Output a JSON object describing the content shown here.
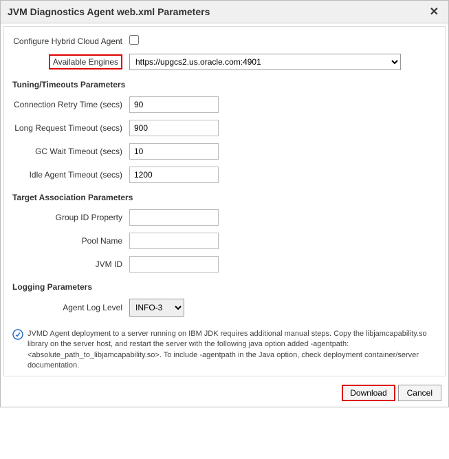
{
  "dialog": {
    "title": "JVM Diagnostics Agent web.xml Parameters"
  },
  "hybrid": {
    "label": "Configure Hybrid Cloud Agent",
    "checked": false
  },
  "engines": {
    "label": "Available Engines",
    "selected": "https://upgcs2.us.oracle.com:4901"
  },
  "sections": {
    "tuning": "Tuning/Timeouts Parameters",
    "target": "Target Association Parameters",
    "logging": "Logging Parameters"
  },
  "tuning": {
    "conn_retry_label": "Connection Retry Time (secs)",
    "conn_retry_value": "90",
    "long_req_label": "Long Request Timeout (secs)",
    "long_req_value": "900",
    "gc_wait_label": "GC Wait Timeout (secs)",
    "gc_wait_value": "10",
    "idle_agent_label": "Idle Agent Timeout (secs)",
    "idle_agent_value": "1200"
  },
  "target": {
    "group_id_label": "Group ID Property",
    "group_id_value": "",
    "pool_name_label": "Pool Name",
    "pool_name_value": "",
    "jvm_id_label": "JVM ID",
    "jvm_id_value": ""
  },
  "logging": {
    "log_level_label": "Agent Log Level",
    "log_level_value": "INFO-3"
  },
  "info": {
    "text": "JVMD Agent deployment to a server running on IBM JDK requires additional manual steps. Copy the libjamcapability.so library on the server host, and restart the server with the following java option added -agentpath:<absolute_path_to_libjamcapability.so>. To include -agentpath in the Java option, check deployment container/server documentation."
  },
  "buttons": {
    "download": "Download",
    "cancel": "Cancel"
  }
}
